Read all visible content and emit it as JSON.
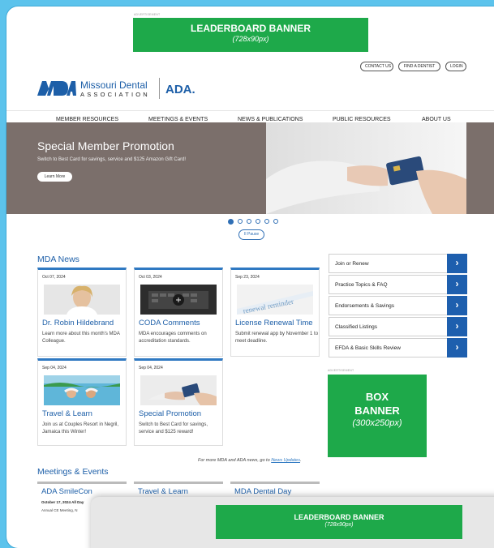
{
  "colors": {
    "brand_blue": "#1d5fa8",
    "banner_green": "#1ea94a",
    "bg_cyan": "#5cc3ec",
    "hero_bg": "#7b6f6b"
  },
  "top_ad": {
    "label": "ADVERTISEMENT",
    "title": "LEADERBOARD BANNER",
    "size": "(728x90px)"
  },
  "utility": {
    "contact": "CONTACT US",
    "find_dentist": "FIND A DENTIST",
    "login": "LOGIN"
  },
  "logo": {
    "name_line1": "Missouri Dental",
    "name_line2": "ASSOCIATION",
    "mda_mark": "MDA",
    "ada": "ADA."
  },
  "nav": [
    "MEMBER RESOURCES",
    "MEETINGS & EVENTS",
    "NEWS & PUBLICATIONS",
    "PUBLIC RESOURCES",
    "ABOUT US"
  ],
  "hero": {
    "title": "Special Member Promotion",
    "subtitle": "Switch to Best Card for savings, service and $125 Amazon Gift Card!",
    "button": "Learn More"
  },
  "carousel": {
    "pause": "II Pause",
    "slides": 6,
    "active_slide": 1
  },
  "news": {
    "title": "MDA News",
    "cards": [
      {
        "date": "Oct 07, 2024",
        "title": "Dr. Robin Hildebrand",
        "desc": "Learn more about this month's MDA Colleague.",
        "image": "dentist-portrait-image"
      },
      {
        "date": "Oct 03, 2024",
        "title": "CODA Comments",
        "desc": "MDA encourages comments on accreditation standards.",
        "image": "laptop-keyboard-image"
      },
      {
        "date": "Sep 23, 2024",
        "title": "License Renewal Time",
        "desc": "Submit renewal app by November 1 to meet deadline.",
        "image": "renewal-reminder-image"
      },
      {
        "date": "Sep 04, 2024",
        "title": "Travel & Learn",
        "desc": "Join us at Couples Resort in Negril, Jamaica this Winter!",
        "image": "resort-pool-image"
      },
      {
        "date": "Sep 04, 2024",
        "title": "Special Promotion",
        "desc": "Switch to Best Card for savings, service and $125 reward!",
        "image": "credit-card-image"
      }
    ],
    "more_prefix": "For more MDA and ADA news, go to ",
    "more_link": "News Updates",
    "more_suffix": "."
  },
  "sidebar": [
    "Join or Renew",
    "Practice Topics & FAQ",
    "Endorsements & Savings",
    "Classified Listings",
    "EFDA & Basic Skills Review"
  ],
  "box_ad": {
    "label": "ADVERTISEMENT",
    "line1": "BOX",
    "line2": "BANNER",
    "size": "(300x250px)"
  },
  "events": {
    "title": "Meetings & Events",
    "cards": [
      {
        "title": "ADA SmileCon",
        "date": "October 17, 2024 All Day",
        "desc": "Annual CE Meeting, N"
      },
      {
        "title": "Travel & Learn",
        "date": "",
        "desc": ""
      },
      {
        "title": "MDA Dental Day",
        "date": "",
        "desc": ""
      }
    ]
  },
  "bottom_ad": {
    "title": "LEADERBOARD BANNER",
    "size": "(728x90px)"
  }
}
